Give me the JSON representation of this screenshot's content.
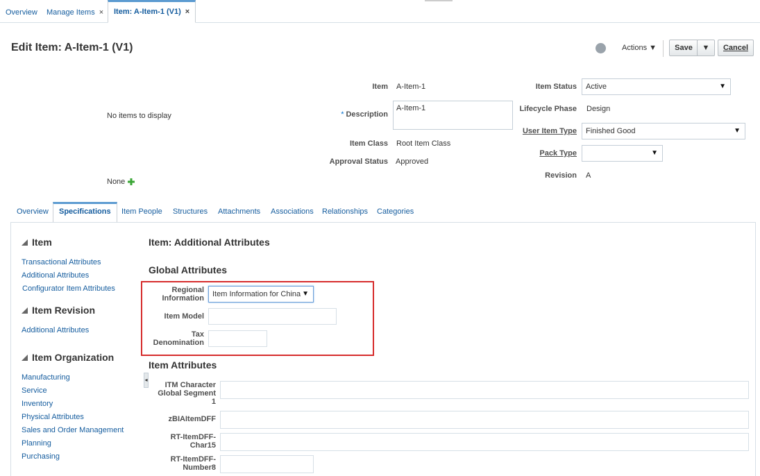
{
  "top_tabs": {
    "overview": "Overview",
    "manage_items": "Manage Items",
    "item": "Item: A-Item-1 (V1)",
    "close": "×"
  },
  "header": {
    "title": "Edit Item: A-Item-1 (V1)",
    "actions": "Actions",
    "save": "Save",
    "cancel": "Cancel"
  },
  "summary": {
    "no_items": "No items to display",
    "none": "None",
    "item_label": "Item",
    "item_value": "A-Item-1",
    "description_label": "Description",
    "description_required": "*",
    "description_value": "A-Item-1",
    "item_class_label": "Item Class",
    "item_class_value": "Root Item Class",
    "approval_label": "Approval Status",
    "approval_value": "Approved",
    "item_status_label": "Item Status",
    "item_status_value": "Active",
    "lifecycle_label": "Lifecycle Phase",
    "lifecycle_value": "Design",
    "user_item_type_label": "User Item Type",
    "user_item_type_value": "Finished Good",
    "pack_type_label": "Pack Type",
    "pack_type_value": "",
    "revision_label": "Revision",
    "revision_value": "A"
  },
  "detail_tabs": [
    "Overview",
    "Specifications",
    "Item People",
    "Structures",
    "Attachments",
    "Associations",
    "Relationships",
    "Categories"
  ],
  "sidebar": {
    "item_heading": "Item",
    "item_links": [
      "Transactional Attributes",
      "Additional Attributes",
      "Configurator Item Attributes"
    ],
    "revision_heading": "Item Revision",
    "revision_links": [
      "Additional Attributes"
    ],
    "org_heading": "Item Organization",
    "org_links": [
      "Manufacturing",
      "Service",
      "Inventory",
      "Physical Attributes",
      "Sales and Order Management",
      "Planning",
      "Purchasing"
    ]
  },
  "main": {
    "title": "Item: Additional Attributes",
    "global_heading": "Global Attributes",
    "regional_label_1": "Regional",
    "regional_label_2": "Information",
    "regional_value": "Item Information for China",
    "item_model_label": "Item Model",
    "tax_label_1": "Tax",
    "tax_label_2": "Denomination",
    "item_attr_heading": "Item Attributes",
    "itm_char_1": "ITM Character",
    "itm_char_2": "Global Segment",
    "itm_char_3": "1",
    "zbi_label": "zBIAItemDFF",
    "rt_char_1": "RT-ItemDFF-",
    "rt_char_2": "Char15",
    "rt_num_1": "RT-ItemDFF-",
    "rt_num_2": "Number8"
  },
  "colors": {
    "accent": "#145c9e",
    "highlight": "#d62b2b"
  },
  "icons": {
    "globe": "globe-icon",
    "add": "plus-icon",
    "dropdown": "chevron-down-icon",
    "collapse": "triangle-icon"
  }
}
